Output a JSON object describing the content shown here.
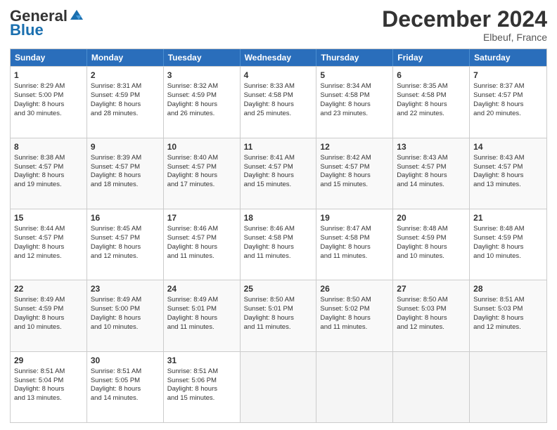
{
  "header": {
    "logo_line1": "General",
    "logo_line2": "Blue",
    "month_title": "December 2024",
    "location": "Elbeuf, France"
  },
  "weekdays": [
    "Sunday",
    "Monday",
    "Tuesday",
    "Wednesday",
    "Thursday",
    "Friday",
    "Saturday"
  ],
  "weeks": [
    [
      {
        "day": "1",
        "lines": [
          "Sunrise: 8:29 AM",
          "Sunset: 5:00 PM",
          "Daylight: 8 hours",
          "and 30 minutes."
        ]
      },
      {
        "day": "2",
        "lines": [
          "Sunrise: 8:31 AM",
          "Sunset: 4:59 PM",
          "Daylight: 8 hours",
          "and 28 minutes."
        ]
      },
      {
        "day": "3",
        "lines": [
          "Sunrise: 8:32 AM",
          "Sunset: 4:59 PM",
          "Daylight: 8 hours",
          "and 26 minutes."
        ]
      },
      {
        "day": "4",
        "lines": [
          "Sunrise: 8:33 AM",
          "Sunset: 4:58 PM",
          "Daylight: 8 hours",
          "and 25 minutes."
        ]
      },
      {
        "day": "5",
        "lines": [
          "Sunrise: 8:34 AM",
          "Sunset: 4:58 PM",
          "Daylight: 8 hours",
          "and 23 minutes."
        ]
      },
      {
        "day": "6",
        "lines": [
          "Sunrise: 8:35 AM",
          "Sunset: 4:58 PM",
          "Daylight: 8 hours",
          "and 22 minutes."
        ]
      },
      {
        "day": "7",
        "lines": [
          "Sunrise: 8:37 AM",
          "Sunset: 4:57 PM",
          "Daylight: 8 hours",
          "and 20 minutes."
        ]
      }
    ],
    [
      {
        "day": "8",
        "lines": [
          "Sunrise: 8:38 AM",
          "Sunset: 4:57 PM",
          "Daylight: 8 hours",
          "and 19 minutes."
        ]
      },
      {
        "day": "9",
        "lines": [
          "Sunrise: 8:39 AM",
          "Sunset: 4:57 PM",
          "Daylight: 8 hours",
          "and 18 minutes."
        ]
      },
      {
        "day": "10",
        "lines": [
          "Sunrise: 8:40 AM",
          "Sunset: 4:57 PM",
          "Daylight: 8 hours",
          "and 17 minutes."
        ]
      },
      {
        "day": "11",
        "lines": [
          "Sunrise: 8:41 AM",
          "Sunset: 4:57 PM",
          "Daylight: 8 hours",
          "and 15 minutes."
        ]
      },
      {
        "day": "12",
        "lines": [
          "Sunrise: 8:42 AM",
          "Sunset: 4:57 PM",
          "Daylight: 8 hours",
          "and 15 minutes."
        ]
      },
      {
        "day": "13",
        "lines": [
          "Sunrise: 8:43 AM",
          "Sunset: 4:57 PM",
          "Daylight: 8 hours",
          "and 14 minutes."
        ]
      },
      {
        "day": "14",
        "lines": [
          "Sunrise: 8:43 AM",
          "Sunset: 4:57 PM",
          "Daylight: 8 hours",
          "and 13 minutes."
        ]
      }
    ],
    [
      {
        "day": "15",
        "lines": [
          "Sunrise: 8:44 AM",
          "Sunset: 4:57 PM",
          "Daylight: 8 hours",
          "and 12 minutes."
        ]
      },
      {
        "day": "16",
        "lines": [
          "Sunrise: 8:45 AM",
          "Sunset: 4:57 PM",
          "Daylight: 8 hours",
          "and 12 minutes."
        ]
      },
      {
        "day": "17",
        "lines": [
          "Sunrise: 8:46 AM",
          "Sunset: 4:57 PM",
          "Daylight: 8 hours",
          "and 11 minutes."
        ]
      },
      {
        "day": "18",
        "lines": [
          "Sunrise: 8:46 AM",
          "Sunset: 4:58 PM",
          "Daylight: 8 hours",
          "and 11 minutes."
        ]
      },
      {
        "day": "19",
        "lines": [
          "Sunrise: 8:47 AM",
          "Sunset: 4:58 PM",
          "Daylight: 8 hours",
          "and 11 minutes."
        ]
      },
      {
        "day": "20",
        "lines": [
          "Sunrise: 8:48 AM",
          "Sunset: 4:59 PM",
          "Daylight: 8 hours",
          "and 10 minutes."
        ]
      },
      {
        "day": "21",
        "lines": [
          "Sunrise: 8:48 AM",
          "Sunset: 4:59 PM",
          "Daylight: 8 hours",
          "and 10 minutes."
        ]
      }
    ],
    [
      {
        "day": "22",
        "lines": [
          "Sunrise: 8:49 AM",
          "Sunset: 4:59 PM",
          "Daylight: 8 hours",
          "and 10 minutes."
        ]
      },
      {
        "day": "23",
        "lines": [
          "Sunrise: 8:49 AM",
          "Sunset: 5:00 PM",
          "Daylight: 8 hours",
          "and 10 minutes."
        ]
      },
      {
        "day": "24",
        "lines": [
          "Sunrise: 8:49 AM",
          "Sunset: 5:01 PM",
          "Daylight: 8 hours",
          "and 11 minutes."
        ]
      },
      {
        "day": "25",
        "lines": [
          "Sunrise: 8:50 AM",
          "Sunset: 5:01 PM",
          "Daylight: 8 hours",
          "and 11 minutes."
        ]
      },
      {
        "day": "26",
        "lines": [
          "Sunrise: 8:50 AM",
          "Sunset: 5:02 PM",
          "Daylight: 8 hours",
          "and 11 minutes."
        ]
      },
      {
        "day": "27",
        "lines": [
          "Sunrise: 8:50 AM",
          "Sunset: 5:03 PM",
          "Daylight: 8 hours",
          "and 12 minutes."
        ]
      },
      {
        "day": "28",
        "lines": [
          "Sunrise: 8:51 AM",
          "Sunset: 5:03 PM",
          "Daylight: 8 hours",
          "and 12 minutes."
        ]
      }
    ],
    [
      {
        "day": "29",
        "lines": [
          "Sunrise: 8:51 AM",
          "Sunset: 5:04 PM",
          "Daylight: 8 hours",
          "and 13 minutes."
        ]
      },
      {
        "day": "30",
        "lines": [
          "Sunrise: 8:51 AM",
          "Sunset: 5:05 PM",
          "Daylight: 8 hours",
          "and 14 minutes."
        ]
      },
      {
        "day": "31",
        "lines": [
          "Sunrise: 8:51 AM",
          "Sunset: 5:06 PM",
          "Daylight: 8 hours",
          "and 15 minutes."
        ]
      },
      null,
      null,
      null,
      null
    ]
  ]
}
